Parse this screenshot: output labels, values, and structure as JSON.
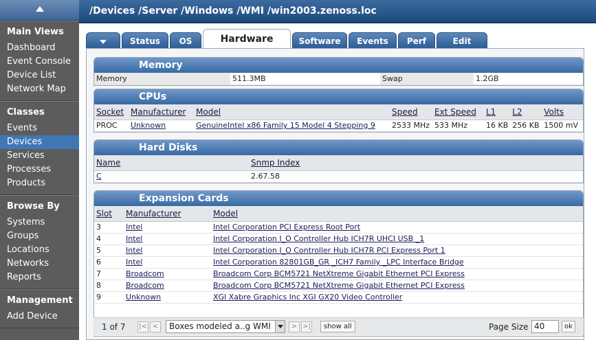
{
  "sidebar": {
    "sections": [
      {
        "heading": "Main Views",
        "items": [
          "Dashboard",
          "Event Console",
          "Device List",
          "Network Map"
        ]
      },
      {
        "heading": "Classes",
        "items": [
          "Events",
          "Devices",
          "Services",
          "Processes",
          "Products"
        ]
      },
      {
        "heading": "Browse By",
        "items": [
          "Systems",
          "Groups",
          "Locations",
          "Networks",
          "Reports"
        ]
      },
      {
        "heading": "Management",
        "items": [
          "Add Device"
        ]
      }
    ],
    "active_item": "Devices"
  },
  "breadcrumb": "/Devices /Server /Windows /WMI /win2003.zenoss.loc",
  "tabs": [
    "Status",
    "OS",
    "Hardware",
    "Software",
    "Events",
    "Perf",
    "Edit"
  ],
  "active_tab": "Hardware",
  "memory": {
    "title": "Memory",
    "memory_label": "Memory",
    "memory_value": "511.3MB",
    "swap_label": "Swap",
    "swap_value": "1.2GB"
  },
  "cpus": {
    "title": "CPUs",
    "headers": [
      "Socket",
      "Manufacturer",
      "Model",
      "Speed",
      "Ext Speed",
      "L1",
      "L2",
      "Volts"
    ],
    "rows": [
      [
        "PROC",
        "Unknown",
        "GenuineIntel x86 Family 15 Model 4 Stepping 9",
        "2533 MHz",
        "533 MHz",
        "16 KB",
        "256 KB",
        "1500 mV"
      ]
    ]
  },
  "hard_disks": {
    "title": "Hard Disks",
    "headers": [
      "Name",
      "Snmp Index"
    ],
    "rows": [
      [
        "C",
        "2.67.58"
      ]
    ]
  },
  "expansion_cards": {
    "title": "Expansion Cards",
    "headers": [
      "Slot",
      "Manufacturer",
      "Model"
    ],
    "rows": [
      [
        "3",
        "Intel",
        "Intel Corporation PCI Express Root Port"
      ],
      [
        "4",
        "Intel",
        "Intel Corporation I_O Controller Hub ICH7R UHCI USB _1"
      ],
      [
        "5",
        "Intel",
        "Intel Corporation I_O Controller Hub ICH7R PCI Express Port 1"
      ],
      [
        "6",
        "Intel",
        "Intel Corporation 82801GB_GR _ICH7 Family _LPC Interface Bridge"
      ],
      [
        "7",
        "Broadcom",
        "Broadcom Corp BCM5721 NetXtreme Gigabit Ethernet PCI Express"
      ],
      [
        "8",
        "Broadcom",
        "Broadcom Corp BCM5721 NetXtreme Gigabit Ethernet PCI Express"
      ],
      [
        "9",
        "Unknown",
        "XGI Xabre Graphics Inc XGI GX20 Video Controller"
      ]
    ]
  },
  "pager": {
    "page_label": "1 of 7",
    "first": "|<",
    "prev": "<",
    "next": ">",
    "last": ">|",
    "select_value": "Boxes modeled a..g WMI",
    "show_all": "show all",
    "page_size_label": "Page Size",
    "page_size_value": "40",
    "ok": "ok"
  },
  "colors": {
    "header_blue": "#386aa5",
    "active_nav": "#3f78b5",
    "sidebar_bg": "#5c5c5c"
  }
}
